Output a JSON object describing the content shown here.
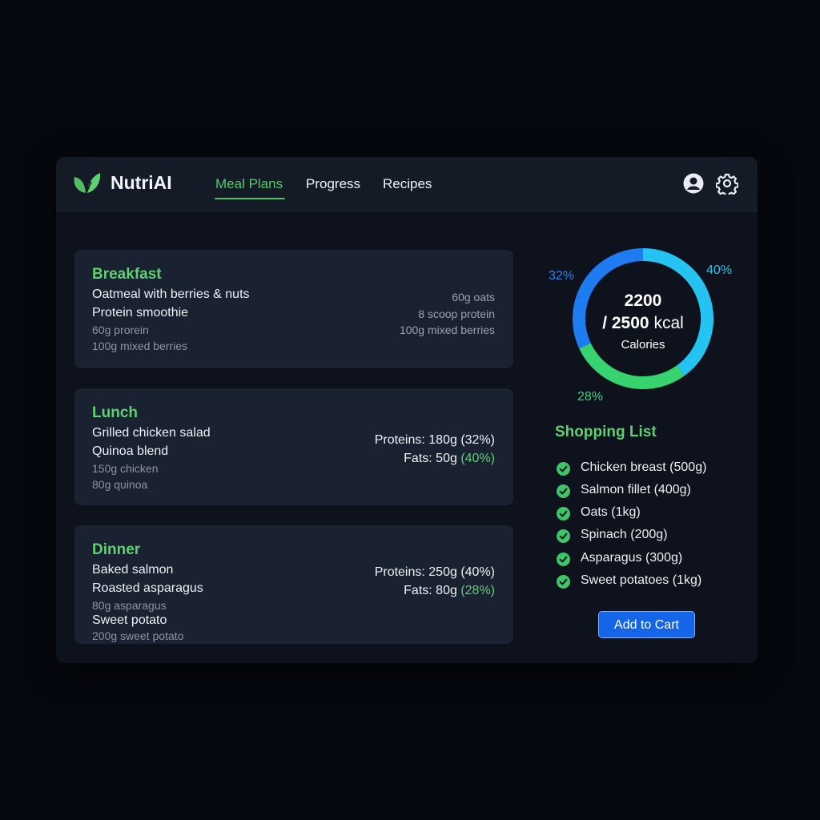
{
  "app": {
    "name": "NutriAI"
  },
  "nav": {
    "tabs": [
      {
        "label": "Meal Plans",
        "active": true
      },
      {
        "label": "Progress",
        "active": false
      },
      {
        "label": "Recipes",
        "active": false
      }
    ]
  },
  "header_icons": [
    "user-icon",
    "gear-icon"
  ],
  "meals": {
    "breakfast": {
      "title": "Breakfast",
      "items": [
        "Oatmeal with berries & nuts",
        "Protein smoothie"
      ],
      "details": [
        "60g prorein",
        "100g mixed berries"
      ],
      "right": [
        "60g oats",
        "8 scoop protein",
        "100g mixed berries"
      ]
    },
    "lunch": {
      "title": "Lunch",
      "items": [
        "Grilled chicken salad",
        "Quinoa blend"
      ],
      "details": [
        "150g chicken",
        "80g quinoa"
      ],
      "proteins": "Proteins: 180g (32%)",
      "fats_label": "Fats: 50g",
      "fats_pct": "(40%)"
    },
    "dinner": {
      "title": "Dinner",
      "items": [
        "Baked salmon",
        "Roasted asparagus"
      ],
      "details": [
        "80g asparagus"
      ],
      "item3": "Sweet potato",
      "detail3": "200g sweet potato",
      "proteins": "Proteins: 250g (40%)",
      "fats_label": "Fats: 80g",
      "fats_pct": "(28%)"
    }
  },
  "calories": {
    "consumed": "2200",
    "goal_line": "/ 2500",
    "unit": "kcal",
    "label": "Calories",
    "segments": [
      {
        "label": "32%",
        "value": 32,
        "color": "#1f7cf0"
      },
      {
        "label": "40%",
        "value": 40,
        "color": "#25c3f2"
      },
      {
        "label": "28%",
        "value": 28,
        "color": "#37d36f"
      }
    ]
  },
  "shopping": {
    "title": "Shopping List",
    "items": [
      "Chicken breast (500g)",
      "Salmon fillet (400g)",
      "Oats (1kg)",
      "Spinach (200g)",
      "Asparagus (300g)",
      "Sweet potatoes (1kg)"
    ],
    "button": "Add to Cart"
  },
  "colors": {
    "accent": "#5fcf73",
    "button": "#1565e8",
    "background": "#05080f"
  }
}
